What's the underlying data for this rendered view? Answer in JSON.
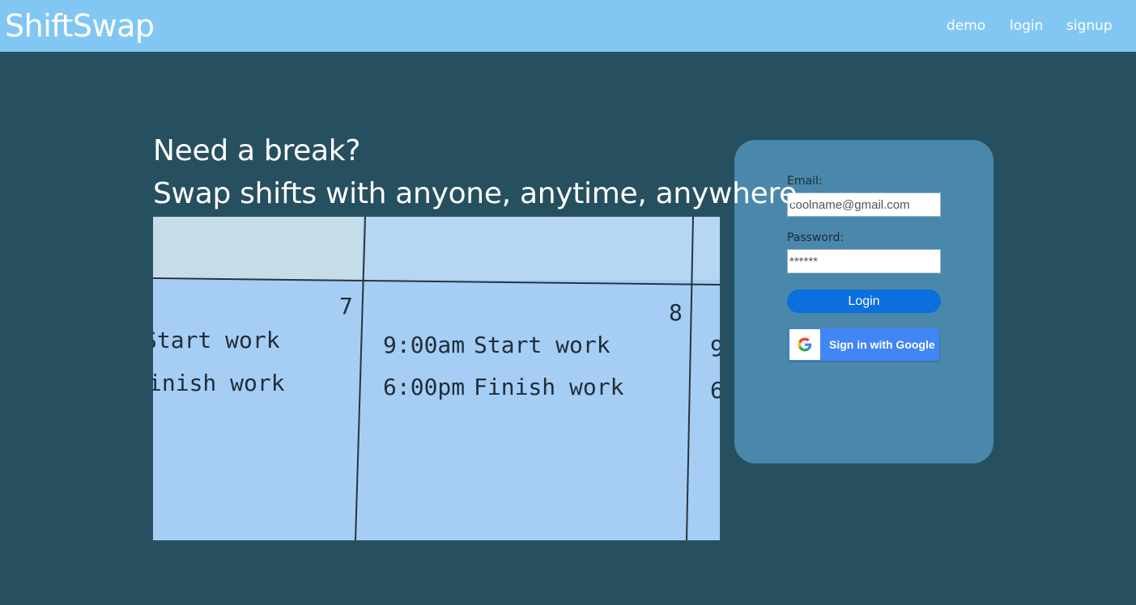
{
  "brand": "ShiftSwap",
  "nav": {
    "demo": "demo",
    "login": "login",
    "signup": "signup"
  },
  "hero": {
    "line1": "Need a break?",
    "line2": "Swap shifts with anyone, anytime, anywhere"
  },
  "schedule_image": {
    "day_a": "7",
    "day_b": "8",
    "a_row1": "Start work",
    "a_row2": "inish work",
    "b_row1_time": "9:00am",
    "b_row1_text": "Start work",
    "b_row2_time": "6:00pm",
    "b_row2_text": "Finish work",
    "c_row1": "9",
    "c_row2": "6"
  },
  "login_form": {
    "email_label": "Email:",
    "email_value": "coolname@gmail.com",
    "password_label": "Password:",
    "password_value": "******",
    "login_button": "Login",
    "google_button": "Sign in with Google"
  },
  "colors": {
    "navbar": "#82c7f3",
    "background": "#26505f",
    "card": "#4a88ab",
    "login_button": "#0b6fde",
    "google_button": "#4285f4"
  }
}
